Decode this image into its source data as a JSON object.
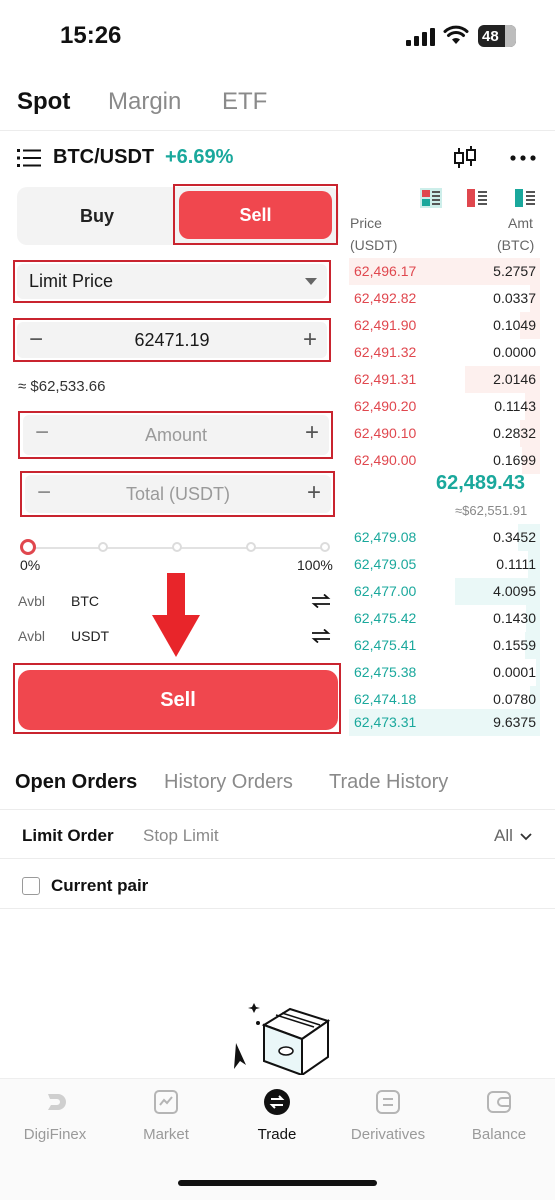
{
  "status_bar": {
    "time": "15:26",
    "battery": "48"
  },
  "top_tabs": [
    "Spot",
    "Margin",
    "ETF"
  ],
  "pair": {
    "name": "BTC/USDT",
    "change": "+6.69%"
  },
  "trade_panel": {
    "buy_label": "Buy",
    "sell_label": "Sell",
    "order_type": "Limit Price",
    "price_value": "62471.19",
    "approx_value": "≈ $62,533.66",
    "amount_placeholder": "Amount",
    "total_placeholder": "Total (USDT)",
    "minus": "−",
    "plus": "+",
    "slider_min": "0%",
    "slider_max": "100%",
    "slider_value_pct": 0,
    "avbl_label": "Avbl",
    "avbl_btc": "BTC",
    "avbl_usdt": "USDT",
    "submit_label": "Sell"
  },
  "order_book": {
    "price_header": "Price",
    "price_unit": "(USDT)",
    "amount_header": "Amt",
    "amount_unit": "(BTC)",
    "asks": [
      {
        "price": "62,496.17",
        "amount": "5.2757"
      },
      {
        "price": "62,492.82",
        "amount": "0.0337"
      },
      {
        "price": "62,491.90",
        "amount": "0.1049"
      },
      {
        "price": "62,491.32",
        "amount": "0.0000"
      },
      {
        "price": "62,491.31",
        "amount": "2.0146"
      },
      {
        "price": "62,490.20",
        "amount": "0.1143"
      },
      {
        "price": "62,490.10",
        "amount": "0.2832"
      },
      {
        "price": "62,490.00",
        "amount": "0.1699"
      }
    ],
    "last_price": "62,489.43",
    "last_price_usd": "≈$62,551.91",
    "bids": [
      {
        "price": "62,479.08",
        "amount": "0.3452"
      },
      {
        "price": "62,479.05",
        "amount": "0.1111"
      },
      {
        "price": "62,477.00",
        "amount": "4.0095"
      },
      {
        "price": "62,475.42",
        "amount": "0.1430"
      },
      {
        "price": "62,475.41",
        "amount": "0.1559"
      },
      {
        "price": "62,475.38",
        "amount": "0.0001"
      },
      {
        "price": "62,474.18",
        "amount": "0.0780"
      },
      {
        "price": "62,473.31",
        "amount": "9.6375"
      }
    ]
  },
  "orders": {
    "tabs": [
      "Open Orders",
      "History Orders",
      "Trade History"
    ],
    "sub_tabs": [
      "Limit Order",
      "Stop Limit"
    ],
    "filter": "All",
    "current_pair_label": "Current pair"
  },
  "bottom_nav": [
    "DigiFinex",
    "Market",
    "Trade",
    "Derivatives",
    "Balance"
  ],
  "colors": {
    "sell": "#f0474e",
    "buy_green": "#1aa89c",
    "highlight": "#c9242f"
  }
}
